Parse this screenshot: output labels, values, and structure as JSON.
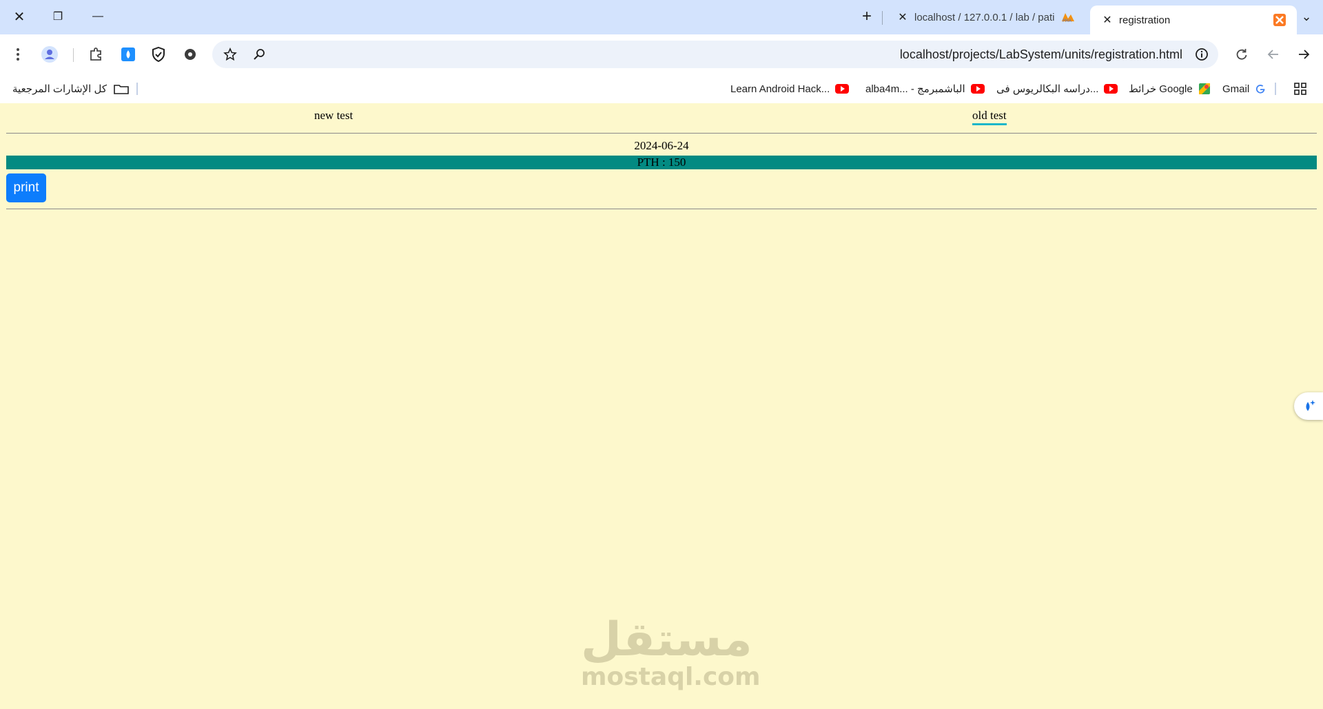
{
  "browser": {
    "window_buttons": {
      "close": "✕",
      "restore": "❐",
      "minimize": "—"
    },
    "new_tab": "+",
    "tabs": [
      {
        "title": "localhost / 127.0.0.1 / lab / pati",
        "close": "✕",
        "icon": "phpmyadmin-icon"
      },
      {
        "title": "registration",
        "close": "✕",
        "icon": "xampp-icon"
      }
    ],
    "tab_search": "⌄",
    "url": "localhost/projects/LabSystem/units/registration.html",
    "bookmarks": [
      {
        "label": "كل الإشارات المرجعية",
        "icon": "folder-icon"
      },
      {
        "label": "Learn Android Hack...",
        "icon": "youtube-icon"
      },
      {
        "label": "alba4m... - الباشمبرمج",
        "icon": "youtube-icon"
      },
      {
        "label": "دراسه البكالريوس فى...",
        "icon": "youtube-icon"
      },
      {
        "label": "خرائط Google",
        "icon": "maps-icon"
      },
      {
        "label": "Gmail",
        "icon": "google-icon"
      }
    ]
  },
  "page": {
    "tabs": {
      "new": "new test",
      "old": "old test"
    },
    "date": "2024-06-24",
    "result": "PTH : 150",
    "print_label": "print",
    "accent": "#1bb6c9",
    "bar_color": "#038a82",
    "button_color": "#0d7dfc"
  },
  "watermark": {
    "arabic": "مستقل",
    "latin": "mostaql.com"
  }
}
